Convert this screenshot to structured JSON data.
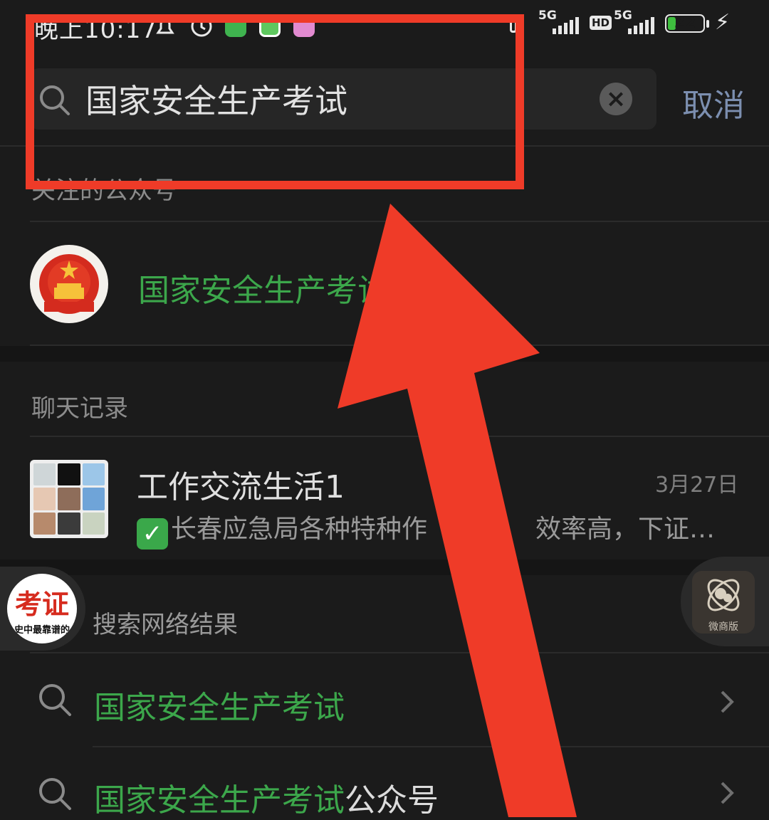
{
  "status_bar": {
    "time": "晚上10:17",
    "net_left": "5G",
    "hd": "HD",
    "net_right": "5G",
    "battery": "22",
    "battery_level": 0.22
  },
  "search": {
    "query": "国家安全生产考试",
    "cancel_label": "取消"
  },
  "sections": {
    "followed_accounts": "关注的公众号",
    "chat_history": "聊天记录",
    "web_results": "搜索网络结果"
  },
  "account": {
    "name": "国家安全生产考试"
  },
  "chat": {
    "title": "工作交流生活1",
    "date": "3月27日",
    "preview_start": "长春应急局各种特种作",
    "preview_end": "效率高，下证…"
  },
  "web_results": [
    {
      "highlight": "国家安全生产考试",
      "suffix": ""
    },
    {
      "highlight": "国家安全生产考试",
      "suffix": "公众号"
    }
  ],
  "floating": {
    "left_badge_top": "考证",
    "left_badge_bottom": "史中最靠谱的",
    "right_label": "微商版"
  },
  "colors": {
    "background": "#1b1b1b",
    "accent_green": "#3ca74b",
    "annotation_red": "#ef3b28",
    "cancel_blue": "#7c8fb0"
  },
  "icons": {
    "search": "search-icon",
    "clear": "clear-icon",
    "chevron": "chevron-right-icon"
  }
}
